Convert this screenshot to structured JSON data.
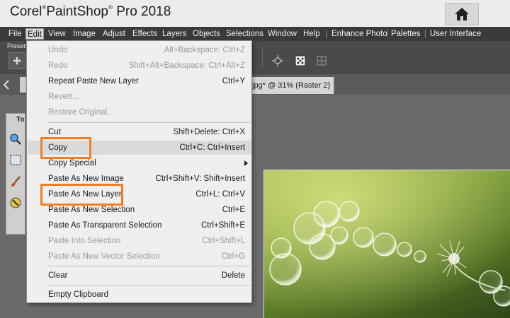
{
  "window": {
    "title_brand": "Corel",
    "title_product": "PaintShop",
    "title_version": "Pro 2018",
    "reg_mark": "®",
    "home_button_icon": "home-icon"
  },
  "menubar": {
    "items": [
      "File",
      "Edit",
      "View",
      "Image",
      "Adjust",
      "Effects",
      "Layers",
      "Objects",
      "Selections",
      "Window",
      "Help",
      "Enhance Photo",
      "Palettes",
      "User Interface"
    ],
    "active_item": "Edit"
  },
  "toolbar": {
    "presets_label": "Presets",
    "icons": [
      "target-icon",
      "dice-icon",
      "grid-align-icon"
    ]
  },
  "tabs": {
    "document_tab": "jpg* @  31% (Raster 2)"
  },
  "tools_palette": {
    "title": "To",
    "tools": [
      "zoom-icon",
      "selection-icon",
      "paint-brush-icon",
      "color-picker-icon"
    ]
  },
  "edit_menu": {
    "items": [
      {
        "label": "Undo",
        "shortcut": "Alt+Backspace: Ctrl+Z",
        "disabled": true
      },
      {
        "label": "Redo",
        "shortcut": "Shift+Alt+Backspace: Ctrl+Alt+Z",
        "disabled": true
      },
      {
        "label": "Repeat  Paste New Layer",
        "shortcut": "Ctrl+Y",
        "disabled": false
      },
      {
        "label": "Revert...",
        "shortcut": "",
        "disabled": true
      },
      {
        "label": "Restore Original...",
        "shortcut": "",
        "disabled": true
      },
      {
        "label": "Cut",
        "shortcut": "Shift+Delete: Ctrl+X",
        "disabled": false
      },
      {
        "label": "Copy",
        "shortcut": "Ctrl+C: Ctrl+Insert",
        "disabled": false
      },
      {
        "label": "Copy Special",
        "shortcut": "",
        "disabled": false,
        "submenu": true
      },
      {
        "label": "Paste As New Image",
        "shortcut": "Ctrl+Shift+V: Shift+Insert",
        "disabled": false
      },
      {
        "label": "Paste As New Layer",
        "shortcut": "Ctrl+L: Ctrl+V",
        "disabled": false
      },
      {
        "label": "Paste As New Selection",
        "shortcut": "Ctrl+E",
        "disabled": false
      },
      {
        "label": "Paste As Transparent Selection",
        "shortcut": "Ctrl+Shift+E",
        "disabled": false
      },
      {
        "label": "Paste Into Selection",
        "shortcut": "Ctrl+Shift+L",
        "disabled": true
      },
      {
        "label": "Paste As New Vector Selection",
        "shortcut": "Ctrl+G",
        "disabled": true
      },
      {
        "label": "Clear",
        "shortcut": "Delete",
        "disabled": false
      },
      {
        "label": "Empty Clipboard",
        "shortcut": "",
        "disabled": false
      }
    ],
    "highlighted_items": [
      "Copy",
      "Paste As New Layer"
    ]
  },
  "colors": {
    "highlight": "#f47d20",
    "menubar_bg": "#3a3a3a",
    "menu_bg": "#efefef"
  }
}
